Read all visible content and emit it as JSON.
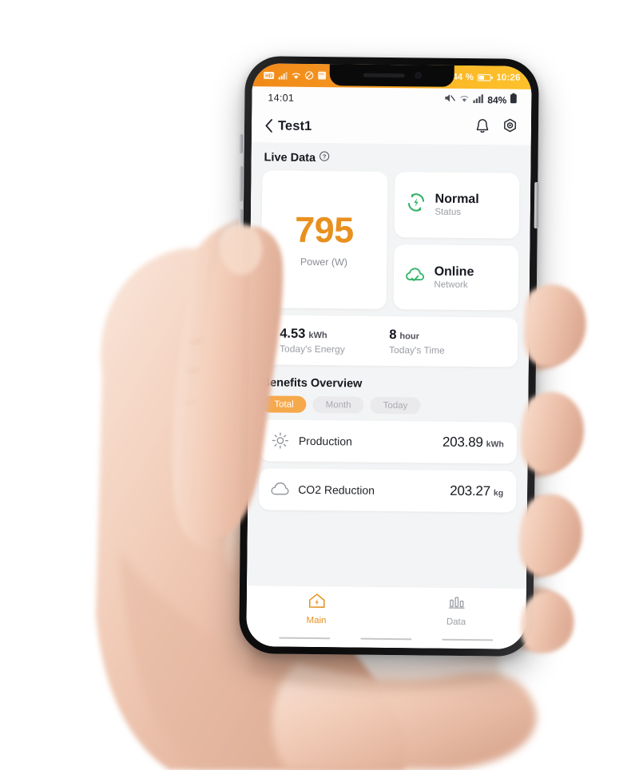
{
  "os_status_bar": {
    "icons": [
      "hd-badge-icon",
      "signal-icon",
      "wifi-icon",
      "do-not-disturb-icon",
      "sd-card-icon"
    ],
    "battery_percent": "44 %",
    "time": "10:26"
  },
  "app_status_bar": {
    "time": "14:01",
    "icons": [
      "mute-icon",
      "wifi-icon",
      "signal-icon"
    ],
    "battery_percent": "84%"
  },
  "header": {
    "back_label": "Test1",
    "notification_icon": "bell-icon",
    "settings_icon": "gear-icon"
  },
  "live_data": {
    "section_title": "Live Data",
    "help_icon": "question-circle-icon",
    "power": {
      "value": "795",
      "label": "Power (W)"
    },
    "status": {
      "icon": "refresh-lightning-icon",
      "value": "Normal",
      "label": "Status"
    },
    "network": {
      "icon": "cloud-check-icon",
      "value": "Online",
      "label": "Network"
    },
    "today": [
      {
        "number": "4.53",
        "unit": "kWh",
        "caption": "Today's Energy"
      },
      {
        "number": "8",
        "unit": "hour",
        "caption": "Today's Time"
      }
    ]
  },
  "benefits": {
    "section_title": "Benefits Overview",
    "tabs": [
      {
        "label": "Total",
        "active": true
      },
      {
        "label": "Month",
        "active": false
      },
      {
        "label": "Today",
        "active": false
      }
    ],
    "rows": [
      {
        "icon": "sun-icon",
        "name": "Production",
        "value": "203.89",
        "unit": "kWh"
      },
      {
        "icon": "cloud-icon",
        "name": "CO2 Reduction",
        "value": "203.27",
        "unit": "kg"
      }
    ]
  },
  "bottom_nav": [
    {
      "icon": "home-solar-icon",
      "label": "Main",
      "active": true
    },
    {
      "icon": "bar-chart-icon",
      "label": "Data",
      "active": false
    }
  ],
  "colors": {
    "accent_orange": "#e8901f",
    "tab_orange": "#f6a94b",
    "status_green": "#35b46a",
    "screen_bg": "#f3f4f5",
    "card_bg": "#ffffff"
  }
}
